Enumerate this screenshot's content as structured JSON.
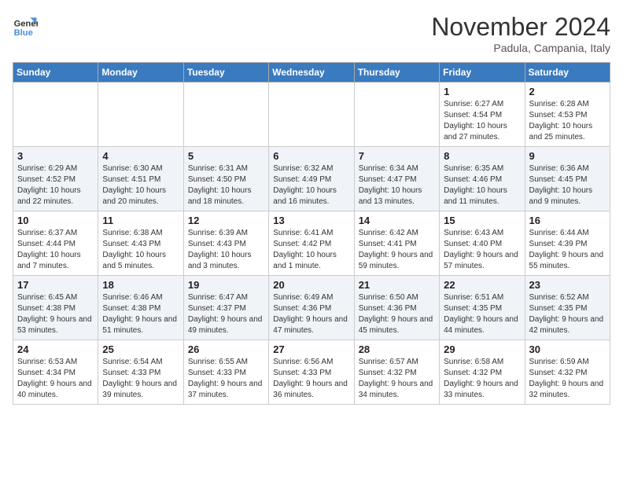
{
  "logo": {
    "line1": "General",
    "line2": "Blue"
  },
  "title": "November 2024",
  "location": "Padula, Campania, Italy",
  "days_of_week": [
    "Sunday",
    "Monday",
    "Tuesday",
    "Wednesday",
    "Thursday",
    "Friday",
    "Saturday"
  ],
  "weeks": [
    [
      {
        "day": "",
        "info": ""
      },
      {
        "day": "",
        "info": ""
      },
      {
        "day": "",
        "info": ""
      },
      {
        "day": "",
        "info": ""
      },
      {
        "day": "",
        "info": ""
      },
      {
        "day": "1",
        "info": "Sunrise: 6:27 AM\nSunset: 4:54 PM\nDaylight: 10 hours and 27 minutes."
      },
      {
        "day": "2",
        "info": "Sunrise: 6:28 AM\nSunset: 4:53 PM\nDaylight: 10 hours and 25 minutes."
      }
    ],
    [
      {
        "day": "3",
        "info": "Sunrise: 6:29 AM\nSunset: 4:52 PM\nDaylight: 10 hours and 22 minutes."
      },
      {
        "day": "4",
        "info": "Sunrise: 6:30 AM\nSunset: 4:51 PM\nDaylight: 10 hours and 20 minutes."
      },
      {
        "day": "5",
        "info": "Sunrise: 6:31 AM\nSunset: 4:50 PM\nDaylight: 10 hours and 18 minutes."
      },
      {
        "day": "6",
        "info": "Sunrise: 6:32 AM\nSunset: 4:49 PM\nDaylight: 10 hours and 16 minutes."
      },
      {
        "day": "7",
        "info": "Sunrise: 6:34 AM\nSunset: 4:47 PM\nDaylight: 10 hours and 13 minutes."
      },
      {
        "day": "8",
        "info": "Sunrise: 6:35 AM\nSunset: 4:46 PM\nDaylight: 10 hours and 11 minutes."
      },
      {
        "day": "9",
        "info": "Sunrise: 6:36 AM\nSunset: 4:45 PM\nDaylight: 10 hours and 9 minutes."
      }
    ],
    [
      {
        "day": "10",
        "info": "Sunrise: 6:37 AM\nSunset: 4:44 PM\nDaylight: 10 hours and 7 minutes."
      },
      {
        "day": "11",
        "info": "Sunrise: 6:38 AM\nSunset: 4:43 PM\nDaylight: 10 hours and 5 minutes."
      },
      {
        "day": "12",
        "info": "Sunrise: 6:39 AM\nSunset: 4:43 PM\nDaylight: 10 hours and 3 minutes."
      },
      {
        "day": "13",
        "info": "Sunrise: 6:41 AM\nSunset: 4:42 PM\nDaylight: 10 hours and 1 minute."
      },
      {
        "day": "14",
        "info": "Sunrise: 6:42 AM\nSunset: 4:41 PM\nDaylight: 9 hours and 59 minutes."
      },
      {
        "day": "15",
        "info": "Sunrise: 6:43 AM\nSunset: 4:40 PM\nDaylight: 9 hours and 57 minutes."
      },
      {
        "day": "16",
        "info": "Sunrise: 6:44 AM\nSunset: 4:39 PM\nDaylight: 9 hours and 55 minutes."
      }
    ],
    [
      {
        "day": "17",
        "info": "Sunrise: 6:45 AM\nSunset: 4:38 PM\nDaylight: 9 hours and 53 minutes."
      },
      {
        "day": "18",
        "info": "Sunrise: 6:46 AM\nSunset: 4:38 PM\nDaylight: 9 hours and 51 minutes."
      },
      {
        "day": "19",
        "info": "Sunrise: 6:47 AM\nSunset: 4:37 PM\nDaylight: 9 hours and 49 minutes."
      },
      {
        "day": "20",
        "info": "Sunrise: 6:49 AM\nSunset: 4:36 PM\nDaylight: 9 hours and 47 minutes."
      },
      {
        "day": "21",
        "info": "Sunrise: 6:50 AM\nSunset: 4:36 PM\nDaylight: 9 hours and 45 minutes."
      },
      {
        "day": "22",
        "info": "Sunrise: 6:51 AM\nSunset: 4:35 PM\nDaylight: 9 hours and 44 minutes."
      },
      {
        "day": "23",
        "info": "Sunrise: 6:52 AM\nSunset: 4:35 PM\nDaylight: 9 hours and 42 minutes."
      }
    ],
    [
      {
        "day": "24",
        "info": "Sunrise: 6:53 AM\nSunset: 4:34 PM\nDaylight: 9 hours and 40 minutes."
      },
      {
        "day": "25",
        "info": "Sunrise: 6:54 AM\nSunset: 4:33 PM\nDaylight: 9 hours and 39 minutes."
      },
      {
        "day": "26",
        "info": "Sunrise: 6:55 AM\nSunset: 4:33 PM\nDaylight: 9 hours and 37 minutes."
      },
      {
        "day": "27",
        "info": "Sunrise: 6:56 AM\nSunset: 4:33 PM\nDaylight: 9 hours and 36 minutes."
      },
      {
        "day": "28",
        "info": "Sunrise: 6:57 AM\nSunset: 4:32 PM\nDaylight: 9 hours and 34 minutes."
      },
      {
        "day": "29",
        "info": "Sunrise: 6:58 AM\nSunset: 4:32 PM\nDaylight: 9 hours and 33 minutes."
      },
      {
        "day": "30",
        "info": "Sunrise: 6:59 AM\nSunset: 4:32 PM\nDaylight: 9 hours and 32 minutes."
      }
    ]
  ]
}
